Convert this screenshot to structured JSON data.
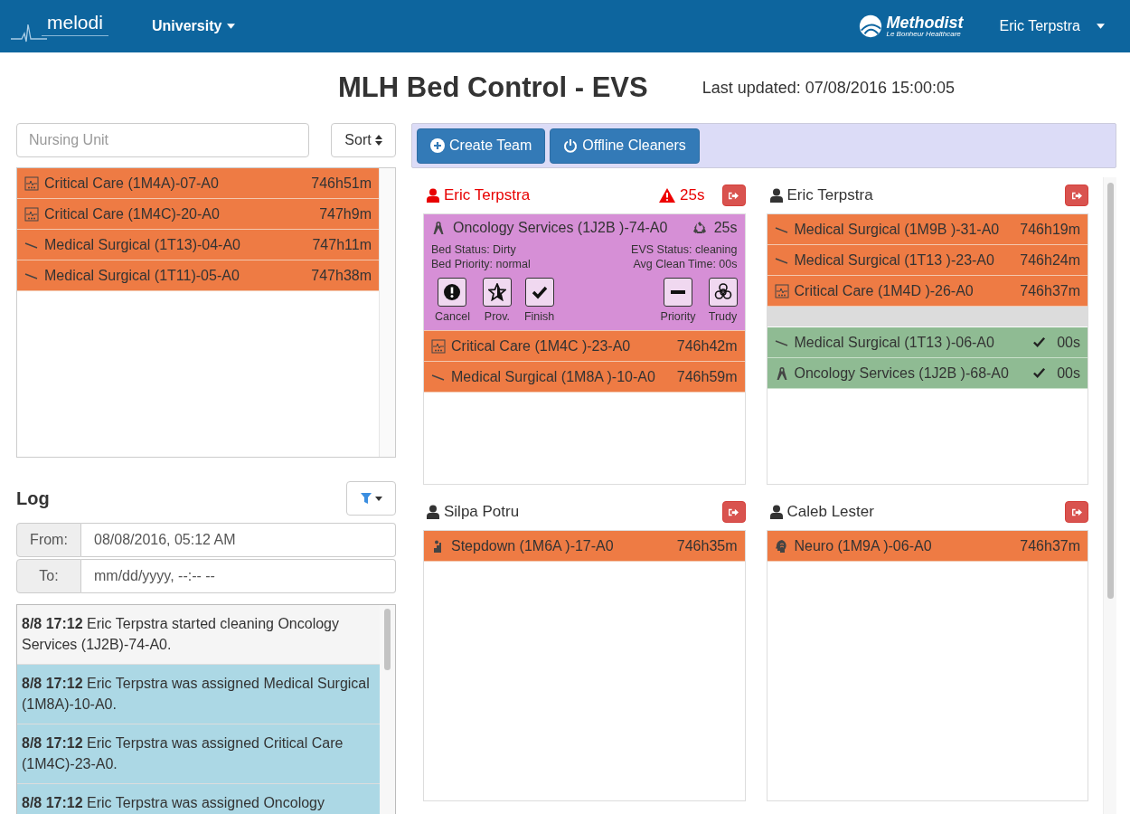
{
  "header": {
    "logo": "melodi",
    "menu": "University",
    "brand": "Methodist",
    "brand_sub": "Le Bonheur Healthcare",
    "user": "Eric Terpstra"
  },
  "title": "MLH Bed Control - EVS",
  "last_updated": "Last updated: 07/08/2016 15:00:05",
  "unit_search": {
    "placeholder": "Nursing Unit"
  },
  "sort_button": "Sort",
  "unassigned_beds": [
    {
      "kind": "critical",
      "name": "Critical Care (1M4A)-07-A0",
      "time": "746h51m"
    },
    {
      "kind": "critical",
      "name": "Critical Care (1M4C)-20-A0",
      "time": "747h9m"
    },
    {
      "kind": "medsurg",
      "name": "Medical Surgical (1T13)-04-A0",
      "time": "747h11m"
    },
    {
      "kind": "medsurg",
      "name": "Medical Surgical (1T11)-05-A0",
      "time": "747h38m"
    }
  ],
  "log": {
    "title": "Log",
    "from_label": "From:",
    "from_value": "08/08/2016, 05:12 AM",
    "to_label": "To:",
    "to_placeholder": "mm/dd/yyyy, --:-- --",
    "entries": [
      {
        "text": "**8/8 17:12** Eric Terpstra started cleaning Oncology Services (1J2B)-74-A0.",
        "highlighted": false
      },
      {
        "text": "**8/8 17:12** Eric Terpstra was assigned Medical Surgical (1M8A)-10-A0.",
        "highlighted": true
      },
      {
        "text": "**8/8 17:12** Eric Terpstra was assigned Critical Care (1M4C)-23-A0.",
        "highlighted": true
      },
      {
        "text": "**8/8 17:12** Eric Terpstra was assigned Oncology",
        "highlighted": true
      }
    ]
  },
  "toolbar": [
    {
      "kind": "create",
      "label": "Create Team"
    },
    {
      "kind": "offline",
      "label": "Offline Cleaners"
    }
  ],
  "teams": [
    {
      "name": "Eric Terpstra",
      "alert": true,
      "alert_time": "25s",
      "active_bed": {
        "kind": "oncology",
        "name": "Oncology Services (1J2B )-74-A0",
        "timer": "25s",
        "bed_status": "Bed Status: Dirty",
        "bed_priority": "Bed Priority: normal",
        "evs_status": "EVS Status: cleaning",
        "avg_clean": "Avg Clean Time: 00s",
        "actions": [
          {
            "kind": "cancel",
            "label": "Cancel"
          },
          {
            "kind": "prov",
            "label": "Prov."
          },
          {
            "kind": "finish",
            "label": "Finish"
          },
          {
            "kind": "priority",
            "label": "Priority"
          },
          {
            "kind": "trudy",
            "label": "Trudy"
          }
        ]
      },
      "beds": [
        {
          "kind": "critical",
          "name": "Critical Care (1M4C )-23-A0",
          "time": "746h42m"
        },
        {
          "kind": "medsurg",
          "name": "Medical Surgical (1M8A )-10-A0",
          "time": "746h59m"
        }
      ]
    },
    {
      "name": "Eric Terpstra",
      "alert": false,
      "beds": [
        {
          "kind": "medsurg",
          "name": "Medical Surgical (1M9B )-31-A0",
          "time": "746h19m"
        },
        {
          "kind": "medsurg",
          "name": "Medical Surgical (1T13 )-23-A0",
          "time": "746h24m"
        },
        {
          "kind": "critical",
          "name": "Critical Care (1M4D )-26-A0",
          "time": "746h37m"
        }
      ],
      "completed": [
        {
          "kind": "medsurg",
          "name": "Medical Surgical (1T13 )-06-A0",
          "time": "00s"
        },
        {
          "kind": "oncology",
          "name": "Oncology Services (1J2B )-68-A0",
          "time": "00s"
        }
      ]
    },
    {
      "name": "Silpa Potru",
      "alert": false,
      "beds": [
        {
          "kind": "stepdown",
          "name": "Stepdown (1M6A )-17-A0",
          "time": "746h35m"
        }
      ]
    },
    {
      "name": "Caleb Lester",
      "alert": false,
      "beds": [
        {
          "kind": "neuro",
          "name": "Neuro (1M9A )-06-A0",
          "time": "746h37m"
        }
      ]
    }
  ]
}
